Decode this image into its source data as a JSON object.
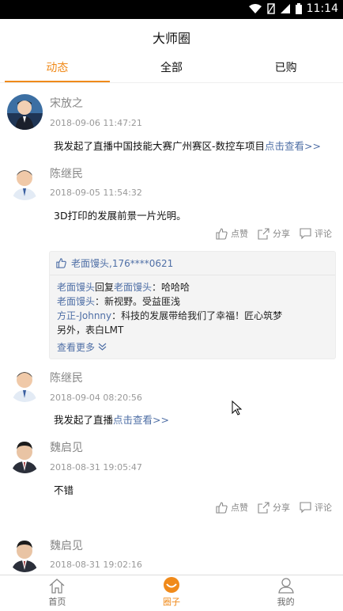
{
  "status_bar": {
    "time": "11:14"
  },
  "header": {
    "title": "大师圈"
  },
  "tabs": [
    {
      "label": "动态",
      "active": true
    },
    {
      "label": "全部",
      "active": false
    },
    {
      "label": "已购",
      "active": false
    }
  ],
  "actions": {
    "like": "点赞",
    "share": "分享",
    "comment": "评论"
  },
  "posts": [
    {
      "author": "宋放之",
      "time": "2018-09-06 11:47:21",
      "text": "我发起了直播中国技能大赛广州赛区-数控车项目",
      "link": "点击查看>>"
    },
    {
      "author": "陈继民",
      "time": "2018-09-05 11:54:32",
      "text": "3D打印的发展前景一片光明。",
      "likes": "老面馒头,176****0621",
      "comments": [
        {
          "from": "老面馒头",
          "verb": "回复",
          "to": "老面馒头",
          "text": "：哈哈哈"
        },
        {
          "from": "老面馒头",
          "text": "：新视野。受益匪浅"
        },
        {
          "from": "方正-Johnny",
          "text": "：科技的发展带给我们了幸福！匠心筑梦"
        },
        {
          "text": "另外，表白LMT"
        }
      ],
      "see_more": "查看更多"
    },
    {
      "author": "陈继民",
      "time": "2018-09-04 08:20:56",
      "text": "我发起了直播",
      "link": "点击查看>>"
    },
    {
      "author": "魏启见",
      "time": "2018-08-31 19:05:47",
      "text": "不错"
    },
    {
      "author": "魏启见",
      "time": "2018-08-31 19:02:16"
    }
  ],
  "bottom_nav": [
    {
      "label": "首页",
      "icon": "home-icon",
      "active": false
    },
    {
      "label": "圈子",
      "icon": "circle-icon",
      "active": true
    },
    {
      "label": "我的",
      "icon": "profile-icon",
      "active": false
    }
  ],
  "colors": {
    "accent": "#f08a1a",
    "link": "#4f6fa6"
  }
}
